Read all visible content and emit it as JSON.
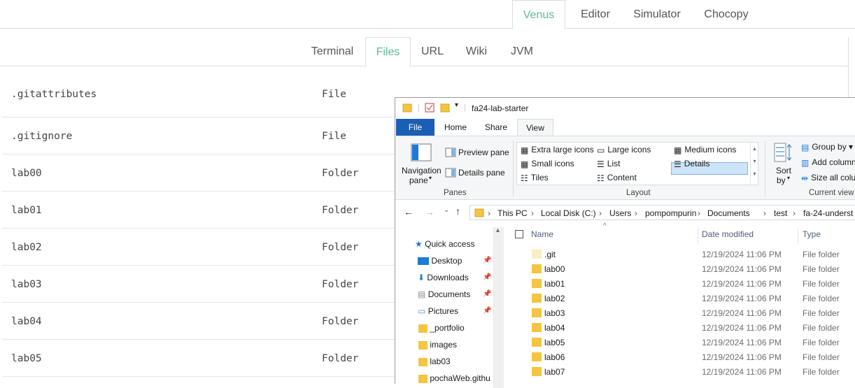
{
  "top_tabs": [
    "Venus",
    "Editor",
    "Simulator",
    "Chocopy"
  ],
  "sub_tabs": [
    "Terminal",
    "Files",
    "URL",
    "Wiki",
    "JVM"
  ],
  "files": [
    {
      "name": ".gitattributes",
      "type": "File"
    },
    {
      "name": ".gitignore",
      "type": "File"
    },
    {
      "name": "lab00",
      "type": "Folder"
    },
    {
      "name": "lab01",
      "type": "Folder"
    },
    {
      "name": "lab02",
      "type": "Folder"
    },
    {
      "name": "lab03",
      "type": "Folder"
    },
    {
      "name": "lab04",
      "type": "Folder"
    },
    {
      "name": "lab05",
      "type": "Folder"
    }
  ],
  "explorer": {
    "title": "fa24-lab-starter",
    "ribbon_tabs": [
      "File",
      "Home",
      "Share",
      "View"
    ],
    "panes": {
      "navigation_pane": "Navigation",
      "navigation_pane_2": "pane",
      "preview_pane": "Preview pane",
      "details_pane": "Details pane",
      "group": "Panes"
    },
    "layout": {
      "extra_large_icons": "Extra large icons",
      "large_icons": "Large icons",
      "medium_icons": "Medium icons",
      "small_icons": "Small icons",
      "list": "List",
      "details": "Details",
      "tiles": "Tiles",
      "content": "Content",
      "group": "Layout"
    },
    "current_view": {
      "sort": "Sort",
      "by": "by",
      "group_by": "Group by",
      "add_columns": "Add column",
      "size_all": "Size all colu",
      "group": "Current view"
    },
    "breadcrumbs": [
      "This PC",
      "Local Disk (C:)",
      "Users",
      "pompompurin",
      "Documents",
      "test",
      "fa-24-underst"
    ],
    "nav": {
      "quick_access": "Quick access",
      "items": [
        "Desktop",
        "Downloads",
        "Documents",
        "Pictures",
        "_portfolio",
        "images",
        "lab03",
        "pochaWeb.githu"
      ]
    },
    "columns": {
      "name": "Name",
      "date": "Date modified",
      "type": "Type"
    },
    "rows": [
      {
        "name": ".git",
        "date": "12/19/2024 11:06 PM",
        "type": "File folder"
      },
      {
        "name": "lab00",
        "date": "12/19/2024 11:06 PM",
        "type": "File folder"
      },
      {
        "name": "lab01",
        "date": "12/19/2024 11:06 PM",
        "type": "File folder"
      },
      {
        "name": "lab02",
        "date": "12/19/2024 11:06 PM",
        "type": "File folder"
      },
      {
        "name": "lab03",
        "date": "12/19/2024 11:06 PM",
        "type": "File folder"
      },
      {
        "name": "lab04",
        "date": "12/19/2024 11:06 PM",
        "type": "File folder"
      },
      {
        "name": "lab05",
        "date": "12/19/2024 11:06 PM",
        "type": "File folder"
      },
      {
        "name": "lab06",
        "date": "12/19/2024 11:06 PM",
        "type": "File folder"
      },
      {
        "name": "lab07",
        "date": "12/19/2024 11:06 PM",
        "type": "File folder"
      }
    ]
  },
  "colors": {
    "accent": "#5fb89c",
    "file_tab": "#1a5fb4",
    "folder": "#f4c542",
    "selection": "#cce4f7"
  }
}
